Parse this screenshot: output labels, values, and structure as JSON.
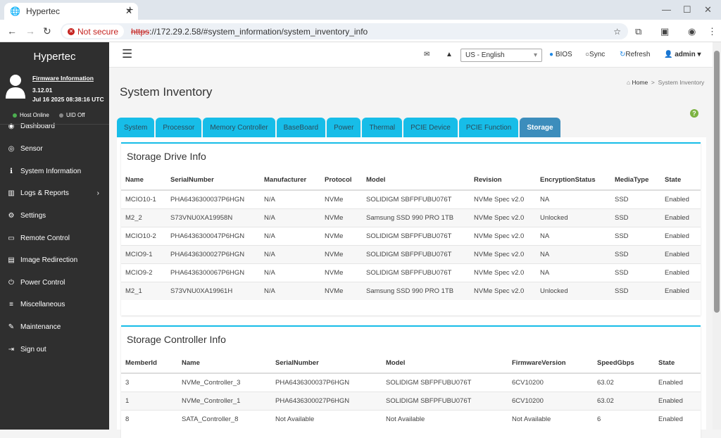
{
  "browser": {
    "tab_title": "Hypertec",
    "not_secure": "Not secure",
    "url_scheme": "https",
    "url_rest": "://172.29.2.58/#system_information/system_inventory_info"
  },
  "sidebar": {
    "brand": "Hypertec",
    "fw_link": "Firmware Information",
    "fw_version": "3.12.01",
    "fw_date": "Jul 16 2025 08:38:16 UTC",
    "host_status": "Host Online",
    "uid_status": "UID Off",
    "items": [
      {
        "label": "Dashboard",
        "icon": "dashboard-icon",
        "glyph": "◉"
      },
      {
        "label": "Sensor",
        "icon": "sensor-icon",
        "glyph": "◎"
      },
      {
        "label": "System Information",
        "icon": "info-icon",
        "glyph": "ℹ"
      },
      {
        "label": "Logs & Reports",
        "icon": "chart-icon",
        "glyph": "▥"
      },
      {
        "label": "Settings",
        "icon": "gear-icon",
        "glyph": "⚙"
      },
      {
        "label": "Remote Control",
        "icon": "monitor-icon",
        "glyph": "▭"
      },
      {
        "label": "Image Redirection",
        "icon": "drive-icon",
        "glyph": "▤"
      },
      {
        "label": "Power Control",
        "icon": "power-icon",
        "glyph": "⏻"
      },
      {
        "label": "Miscellaneous",
        "icon": "list-icon",
        "glyph": "≡"
      },
      {
        "label": "Maintenance",
        "icon": "wrench-icon",
        "glyph": "✎"
      },
      {
        "label": "Sign out",
        "icon": "sign-out-icon",
        "glyph": "⇥"
      }
    ]
  },
  "header": {
    "language": "US - English",
    "bios": "BIOS",
    "sync": "Sync",
    "refresh": "Refresh",
    "user": "admin"
  },
  "page": {
    "title": "System Inventory",
    "breadcrumb_home": "Home",
    "breadcrumb_current": "System Inventory"
  },
  "tabs": [
    "System",
    "Processor",
    "Memory Controller",
    "BaseBoard",
    "Power",
    "Thermal",
    "PCIE Device",
    "PCIE Function",
    "Storage"
  ],
  "active_tab": "Storage",
  "drives": {
    "title": "Storage Drive Info",
    "columns": [
      "Name",
      "SerialNumber",
      "Manufacturer",
      "Protocol",
      "Model",
      "Revision",
      "EncryptionStatus",
      "MediaType",
      "State"
    ],
    "rows": [
      [
        "MCIO10-1",
        "PHA6436300037P6HGN",
        "N/A",
        "NVMe",
        "SOLIDIGM SBFPFUBU076T",
        "NVMe Spec v2.0",
        "NA",
        "SSD",
        "Enabled"
      ],
      [
        "M2_2",
        "S73VNU0XA19958N",
        "N/A",
        "NVMe",
        "Samsung SSD 990 PRO 1TB",
        "NVMe Spec v2.0",
        "Unlocked",
        "SSD",
        "Enabled"
      ],
      [
        "MCIO10-2",
        "PHA6436300047P6HGN",
        "N/A",
        "NVMe",
        "SOLIDIGM SBFPFUBU076T",
        "NVMe Spec v2.0",
        "NA",
        "SSD",
        "Enabled"
      ],
      [
        "MCIO9-1",
        "PHA6436300027P6HGN",
        "N/A",
        "NVMe",
        "SOLIDIGM SBFPFUBU076T",
        "NVMe Spec v2.0",
        "NA",
        "SSD",
        "Enabled"
      ],
      [
        "MCIO9-2",
        "PHA6436300067P6HGN",
        "N/A",
        "NVMe",
        "SOLIDIGM SBFPFUBU076T",
        "NVMe Spec v2.0",
        "NA",
        "SSD",
        "Enabled"
      ],
      [
        "M2_1",
        "S73VNU0XA19961H",
        "N/A",
        "NVMe",
        "Samsung SSD 990 PRO 1TB",
        "NVMe Spec v2.0",
        "Unlocked",
        "SSD",
        "Enabled"
      ]
    ]
  },
  "controllers": {
    "title": "Storage Controller Info",
    "columns": [
      "MemberId",
      "Name",
      "SerialNumber",
      "Model",
      "FirmwareVersion",
      "SpeedGbps",
      "State"
    ],
    "rows": [
      [
        "3",
        "NVMe_Controller_3",
        "PHA6436300037P6HGN",
        "SOLIDIGM SBFPFUBU076T",
        "6CV10200",
        "63.02",
        "Enabled"
      ],
      [
        "1",
        "NVMe_Controller_1",
        "PHA6436300027P6HGN",
        "SOLIDIGM SBFPFUBU076T",
        "6CV10200",
        "63.02",
        "Enabled"
      ],
      [
        "8",
        "SATA_Controller_8",
        "Not Available",
        "Not Available",
        "Not Available",
        "6",
        "Enabled"
      ]
    ]
  },
  "colors": {
    "tab": "#17bde8",
    "tab_active": "#3c8dbc",
    "sidebar": "#2f2f2f",
    "host_online": "#4caf50",
    "uid_off": "#888888"
  }
}
